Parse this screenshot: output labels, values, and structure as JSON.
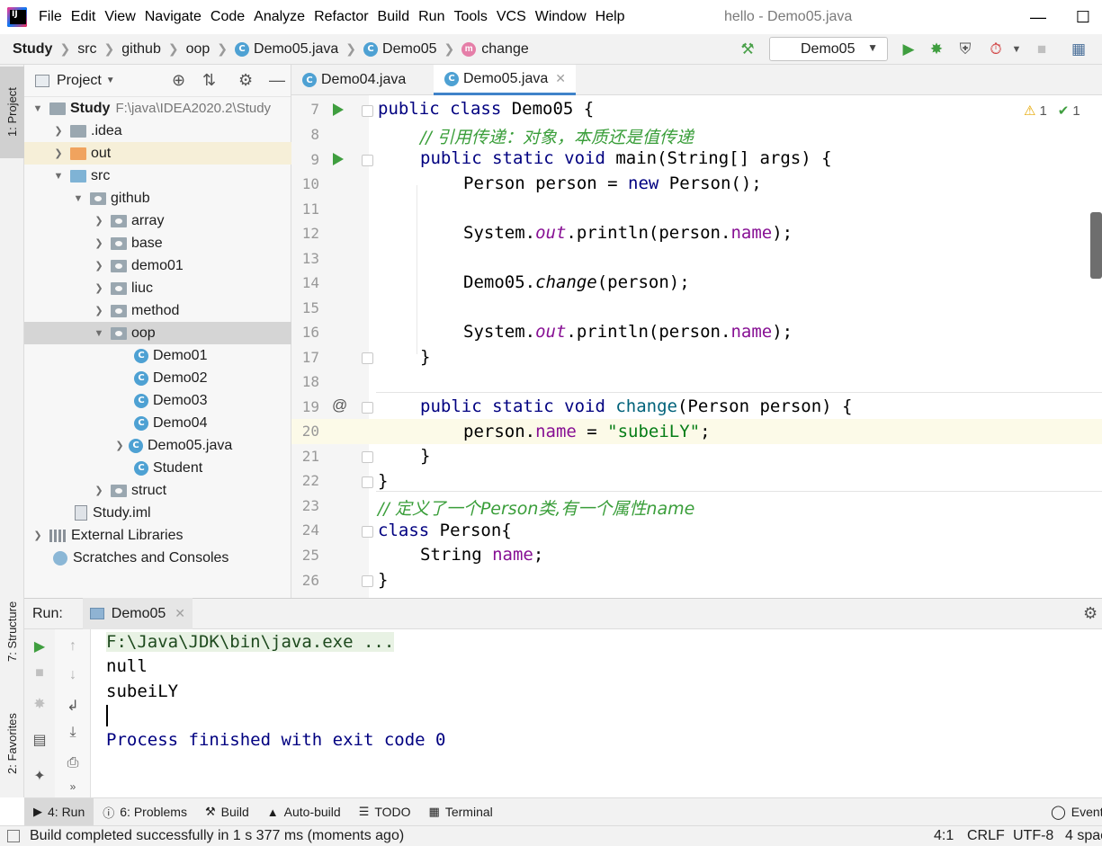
{
  "menubar": {
    "items": [
      "File",
      "Edit",
      "View",
      "Navigate",
      "Code",
      "Analyze",
      "Refactor",
      "Build",
      "Run",
      "Tools",
      "VCS",
      "Window",
      "Help"
    ],
    "window_title": "hello - Demo05.java"
  },
  "navbar": {
    "breadcrumbs": [
      "Study",
      "src",
      "github",
      "oop",
      "Demo05.java",
      "Demo05",
      "change"
    ],
    "run_config": "Demo05"
  },
  "left_strip": {
    "project_tab": "1: Project",
    "structure_tab": "7: Structure",
    "favorites_tab": "2: Favorites"
  },
  "project": {
    "header_label": "Project",
    "tree": [
      {
        "label": "Study",
        "extra": "F:\\java\\IDEA2020.2\\Study"
      },
      {
        "label": ".idea"
      },
      {
        "label": "out"
      },
      {
        "label": "src"
      },
      {
        "label": "github"
      },
      {
        "label": "array"
      },
      {
        "label": "base"
      },
      {
        "label": "demo01"
      },
      {
        "label": "liuc"
      },
      {
        "label": "method"
      },
      {
        "label": "oop"
      },
      {
        "label": "Demo01"
      },
      {
        "label": "Demo02"
      },
      {
        "label": "Demo03"
      },
      {
        "label": "Demo04"
      },
      {
        "label": "Demo05.java"
      },
      {
        "label": "Student"
      },
      {
        "label": "struct"
      },
      {
        "label": "Study.iml"
      },
      {
        "label": "External Libraries"
      },
      {
        "label": "Scratches and Consoles"
      }
    ]
  },
  "editor": {
    "tabs": [
      "Demo04.java",
      "Demo05.java"
    ],
    "active_tab": "Demo05.java",
    "warnings": "1",
    "checks": "1",
    "line_numbers": [
      "7",
      "8",
      "9",
      "10",
      "11",
      "12",
      "13",
      "14",
      "15",
      "16",
      "17",
      "18",
      "19",
      "20",
      "21",
      "22",
      "23",
      "24",
      "25",
      "26"
    ],
    "code": {
      "l7_kw": "public class ",
      "l7_rest": "Demo05 {",
      "l8": "// 引用传递：对象，本质还是值传递",
      "l9_kw": "public static void ",
      "l9_rest": "main(String[] args) {",
      "l10_a": "Person person = ",
      "l10_kw": "new ",
      "l10_b": "Person();",
      "l12_a": "System.",
      "l12_sfld": "out",
      "l12_b": ".println(person.",
      "l12_fld": "name",
      "l12_c": ");",
      "l14_a": "Demo05.",
      "l14_smeth": "change",
      "l14_b": "(person);",
      "l16_a": "System.",
      "l16_sfld": "out",
      "l16_b": ".println(person.",
      "l16_fld": "name",
      "l16_c": ");",
      "l17": "}",
      "l19_kw": "public static void ",
      "l19_meth": "change",
      "l19_rest": "(Person person) {",
      "l20_a": "person.",
      "l20_fld": "name",
      "l20_b": " = ",
      "l20_str": "\"subeiLY\"",
      "l20_c": ";",
      "l21": "}",
      "l22": "}",
      "l23": "// 定义了一个Person类,有一个属性name",
      "l24_kw": "class ",
      "l24_rest": "Person{",
      "l25_a": "String ",
      "l25_fld": "name",
      "l25_b": ";",
      "l26": "}"
    }
  },
  "run": {
    "label": "Run:",
    "tab": "Demo05",
    "output": [
      "F:\\Java\\JDK\\bin\\java.exe ...",
      "null",
      "subeiLY",
      "",
      "Process finished with exit code 0"
    ]
  },
  "toolwin": {
    "items": [
      "4: Run",
      "6: Problems",
      "Build",
      "Auto-build",
      "TODO",
      "Terminal"
    ],
    "event_log": "Event"
  },
  "status": {
    "message": "Build completed successfully in 1 s 377 ms (moments ago)",
    "position": "4:1",
    "line_sep": "CRLF",
    "encoding": "UTF-8",
    "indent": "4 spac"
  },
  "colors": {
    "keyword": "#000080",
    "comment": "#3a9e3a",
    "field": "#871094",
    "string": "#067d17",
    "run_green": "#3f9e3f",
    "accent": "#4083c9"
  }
}
